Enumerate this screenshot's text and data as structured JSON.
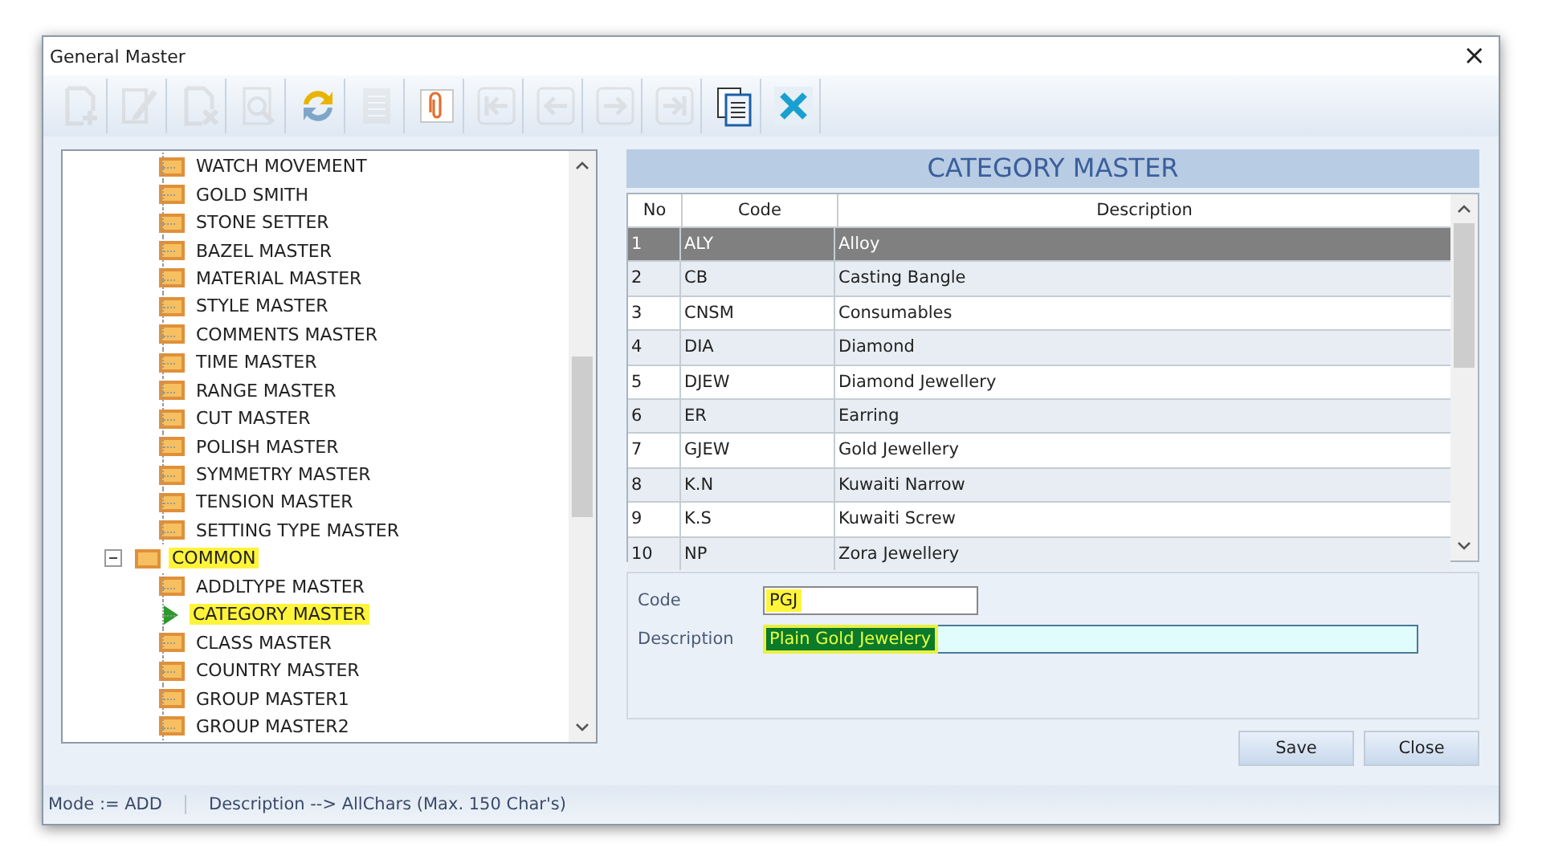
{
  "window": {
    "title": "General Master",
    "close": "×"
  },
  "toolbar": [
    {
      "kind": "new",
      "disabled": true
    },
    {
      "kind": "edit",
      "disabled": true
    },
    {
      "kind": "delete",
      "disabled": true
    },
    {
      "kind": "search",
      "disabled": true
    },
    {
      "kind": "refresh",
      "disabled": false
    },
    {
      "kind": "list",
      "disabled": true
    },
    {
      "kind": "attach",
      "disabled": false
    },
    {
      "kind": "first",
      "disabled": true
    },
    {
      "kind": "prev",
      "disabled": true
    },
    {
      "kind": "next",
      "disabled": true
    },
    {
      "kind": "last",
      "disabled": true
    },
    {
      "kind": "report",
      "disabled": false
    },
    {
      "kind": "exit",
      "disabled": false
    }
  ],
  "tree": {
    "items": [
      {
        "label": "WATCH MOVEMENT",
        "selected": false,
        "highlighted": false
      },
      {
        "label": "GOLD SMITH",
        "selected": false,
        "highlighted": false
      },
      {
        "label": "STONE SETTER",
        "selected": false,
        "highlighted": false
      },
      {
        "label": "BAZEL MASTER",
        "selected": false,
        "highlighted": false
      },
      {
        "label": "MATERIAL MASTER",
        "selected": false,
        "highlighted": false
      },
      {
        "label": "STYLE MASTER",
        "selected": false,
        "highlighted": false
      },
      {
        "label": "COMMENTS MASTER",
        "selected": false,
        "highlighted": false
      },
      {
        "label": "TIME MASTER",
        "selected": false,
        "highlighted": false
      },
      {
        "label": "RANGE MASTER",
        "selected": false,
        "highlighted": false
      },
      {
        "label": "CUT MASTER",
        "selected": false,
        "highlighted": false
      },
      {
        "label": "POLISH MASTER",
        "selected": false,
        "highlighted": false
      },
      {
        "label": "SYMMETRY MASTER",
        "selected": false,
        "highlighted": false
      },
      {
        "label": "TENSION MASTER",
        "selected": false,
        "highlighted": false
      },
      {
        "label": "SETTING TYPE MASTER",
        "selected": false,
        "highlighted": false
      }
    ],
    "groups": [
      {
        "label": "COMMON",
        "expanded": true,
        "highlighted": true,
        "children": [
          {
            "label": "ADDLTYPE MASTER",
            "selected": false,
            "highlighted": false
          },
          {
            "label": "CATEGORY MASTER",
            "selected": true,
            "highlighted": true
          },
          {
            "label": "CLASS MASTER",
            "selected": false,
            "highlighted": false
          },
          {
            "label": "COUNTRY MASTER",
            "selected": false,
            "highlighted": false
          },
          {
            "label": "GROUP MASTER1",
            "selected": false,
            "highlighted": false
          },
          {
            "label": "GROUP MASTER2",
            "selected": false,
            "highlighted": false
          }
        ]
      }
    ]
  },
  "panel": {
    "title": "CATEGORY MASTER"
  },
  "table": {
    "columns": [
      "No",
      "Code",
      "Description"
    ],
    "rows": [
      {
        "no": "1",
        "code": "ALY",
        "description": "Alloy",
        "selected": true
      },
      {
        "no": "2",
        "code": "CB",
        "description": "Casting Bangle",
        "selected": false
      },
      {
        "no": "3",
        "code": "CNSM",
        "description": "Consumables",
        "selected": false
      },
      {
        "no": "4",
        "code": "DIA",
        "description": "Diamond",
        "selected": false
      },
      {
        "no": "5",
        "code": "DJEW",
        "description": "Diamond Jewellery",
        "selected": false
      },
      {
        "no": "6",
        "code": "ER",
        "description": "Earring",
        "selected": false
      },
      {
        "no": "7",
        "code": "GJEW",
        "description": "Gold Jewellery",
        "selected": false
      },
      {
        "no": "8",
        "code": "K.N",
        "description": "Kuwaiti Narrow",
        "selected": false
      },
      {
        "no": "9",
        "code": "K.S",
        "description": "Kuwaiti Screw",
        "selected": false
      },
      {
        "no": "10",
        "code": "NP",
        "description": "Zora Jewellery",
        "selected": false
      }
    ]
  },
  "form": {
    "fields": [
      {
        "label": "Code",
        "value": "PGJ",
        "highlighted": true,
        "focused": false
      },
      {
        "label": "Description",
        "value": "Plain Gold Jewelery",
        "highlighted": true,
        "focused": true
      }
    ]
  },
  "buttons": [
    {
      "label": "Save"
    },
    {
      "label": "Close"
    }
  ],
  "status_bar": [
    "Mode := ADD",
    "Description --> AllChars (Max. 150 Char's)"
  ]
}
